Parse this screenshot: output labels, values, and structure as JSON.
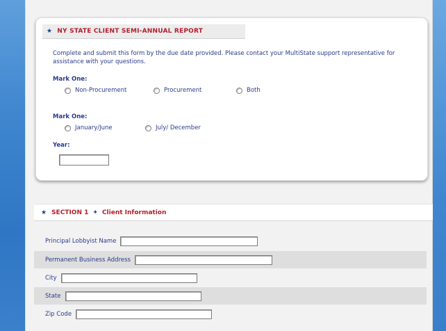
{
  "report": {
    "title": "NY STATE CLIENT SEMI-ANNUAL REPORT",
    "intro": "Complete and submit this form by the due date provided. Please contact your MultiState support representative for assistance with your questions.",
    "mark_one_1": "Mark One:",
    "procurement_options": [
      "Non-Procurement",
      "Procurement",
      "Both"
    ],
    "mark_one_2": "Mark One:",
    "period_options": [
      "January/June",
      "July/ December"
    ],
    "year_label": "Year:",
    "year_value": ""
  },
  "section1": {
    "title_prefix": "SECTION 1",
    "title_suffix": "Client Information",
    "fields": [
      {
        "label": "Principal Lobbyist Name",
        "value": ""
      },
      {
        "label": "Permanent Business Address",
        "value": ""
      },
      {
        "label": "City",
        "value": ""
      },
      {
        "label": "State",
        "value": ""
      },
      {
        "label": "Zip Code",
        "value": ""
      }
    ]
  },
  "icons": {
    "header_marker": "star-icon",
    "section_separator": "diamond-star-icon"
  },
  "colors": {
    "heading_red": "#b31f2b",
    "text_navy": "#2a3a8a",
    "background_blue": "#3f86cf",
    "row_shade": "#dedede"
  }
}
